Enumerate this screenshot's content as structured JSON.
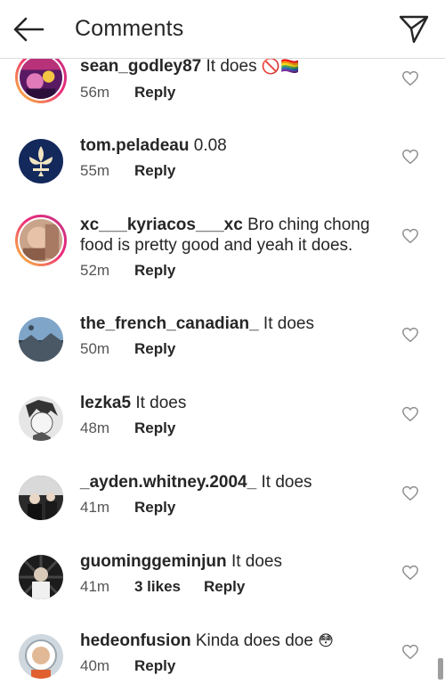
{
  "header": {
    "title": "Comments",
    "back_icon": "arrow-left-icon",
    "send_icon": "paper-plane-icon"
  },
  "colors": {
    "text": "#262626",
    "meta": "#8e8e8e",
    "divider": "#dbdbdb",
    "story_ring": "#ee2a7b"
  },
  "comments": [
    {
      "username": "sean_godley87",
      "text": "It does",
      "emoji": "🚫🏳️‍🌈",
      "time": "56m",
      "likes": "",
      "reply_label": "Reply"
    },
    {
      "username": "tom.peladeau",
      "text": "0.08",
      "emoji": "",
      "time": "55m",
      "likes": "",
      "reply_label": "Reply"
    },
    {
      "username": "xc___kyriacos___xc",
      "text": "Bro ching chong food is pretty good and yeah it does.",
      "emoji": "",
      "time": "52m",
      "likes": "",
      "reply_label": "Reply"
    },
    {
      "username": "the_french_canadian_",
      "text": "It does",
      "emoji": "",
      "time": "50m",
      "likes": "",
      "reply_label": "Reply"
    },
    {
      "username": "lezka5",
      "text": "It does",
      "emoji": "",
      "time": "48m",
      "likes": "",
      "reply_label": "Reply"
    },
    {
      "username": "_ayden.whitney.2004_",
      "text": "It does",
      "emoji": "",
      "time": "41m",
      "likes": "",
      "reply_label": "Reply"
    },
    {
      "username": "guominggeminjun",
      "text": "It does",
      "emoji": "",
      "time": "41m",
      "likes": "3 likes",
      "reply_label": "Reply"
    },
    {
      "username": "hedeonfusion",
      "text": "Kinda does doe",
      "emoji": "😳",
      "time": "40m",
      "likes": "",
      "reply_label": "Reply"
    }
  ]
}
